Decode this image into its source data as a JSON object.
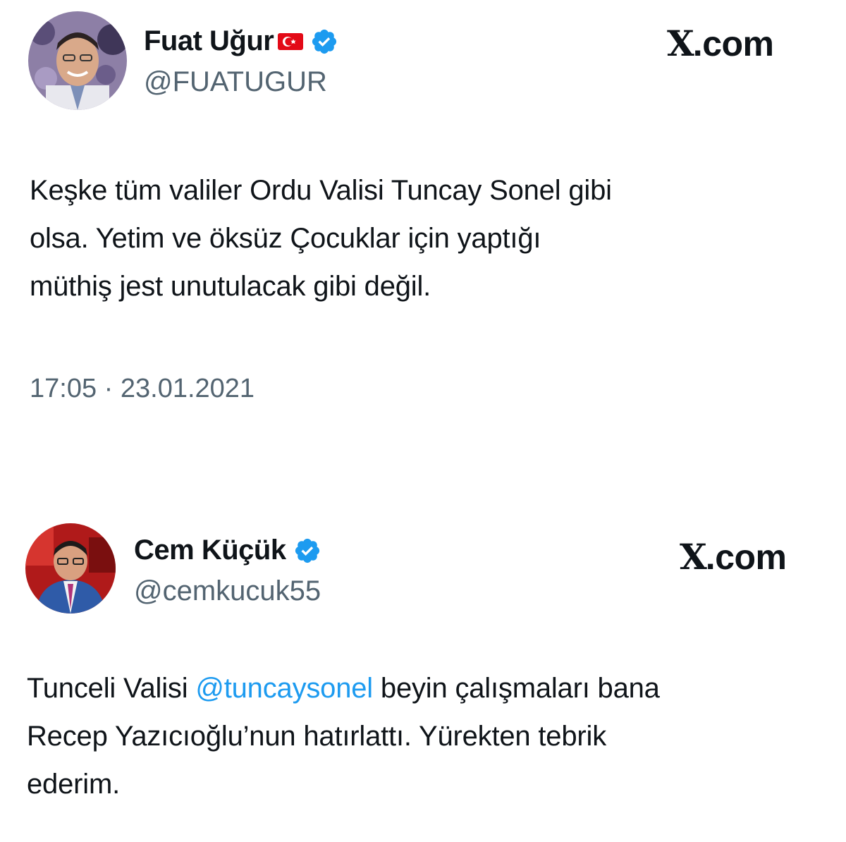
{
  "tweets": [
    {
      "display_name": "Fuat Uğur",
      "handle": "@FUATUGUR",
      "brand": "X.com",
      "brand_x": "X",
      "brand_rest": ".com",
      "text": "Keşke tüm valiler Ordu Valisi Tuncay Sonel gibi olsa. Yetim ve öksüz Çocuklar için yaptığı müthiş jest unutulacak gibi değil.",
      "text_lines": [
        "Keşke tüm valiler Ordu Valisi Tuncay Sonel gibi",
        "olsa. Yetim ve öksüz Çocuklar için yaptığı",
        "müthiş jest unutulacak gibi değil."
      ],
      "timestamp": "17:05 · 23.01.2021",
      "flag_icon": "turkey-flag-icon",
      "verified_icon": "verified-badge-icon"
    },
    {
      "display_name": "Cem Küçük",
      "handle": "@cemkucuk55",
      "brand": "X.com",
      "brand_x": "X",
      "brand_rest": ".com",
      "text_parts": {
        "line1_before": "Tunceli Valisi ",
        "mention": "@tuncaysonel",
        "line1_after": " beyin çalışmaları bana",
        "line2": "Recep Yazıcıoğlu’nun hatırlattı. Yürekten tebrik",
        "line3": "ederim."
      },
      "verified_icon": "verified-badge-icon"
    }
  ],
  "colors": {
    "text": "#0f1419",
    "secondary": "#536471",
    "mention": "#1d9bf0",
    "verified": "#1d9bf0"
  }
}
